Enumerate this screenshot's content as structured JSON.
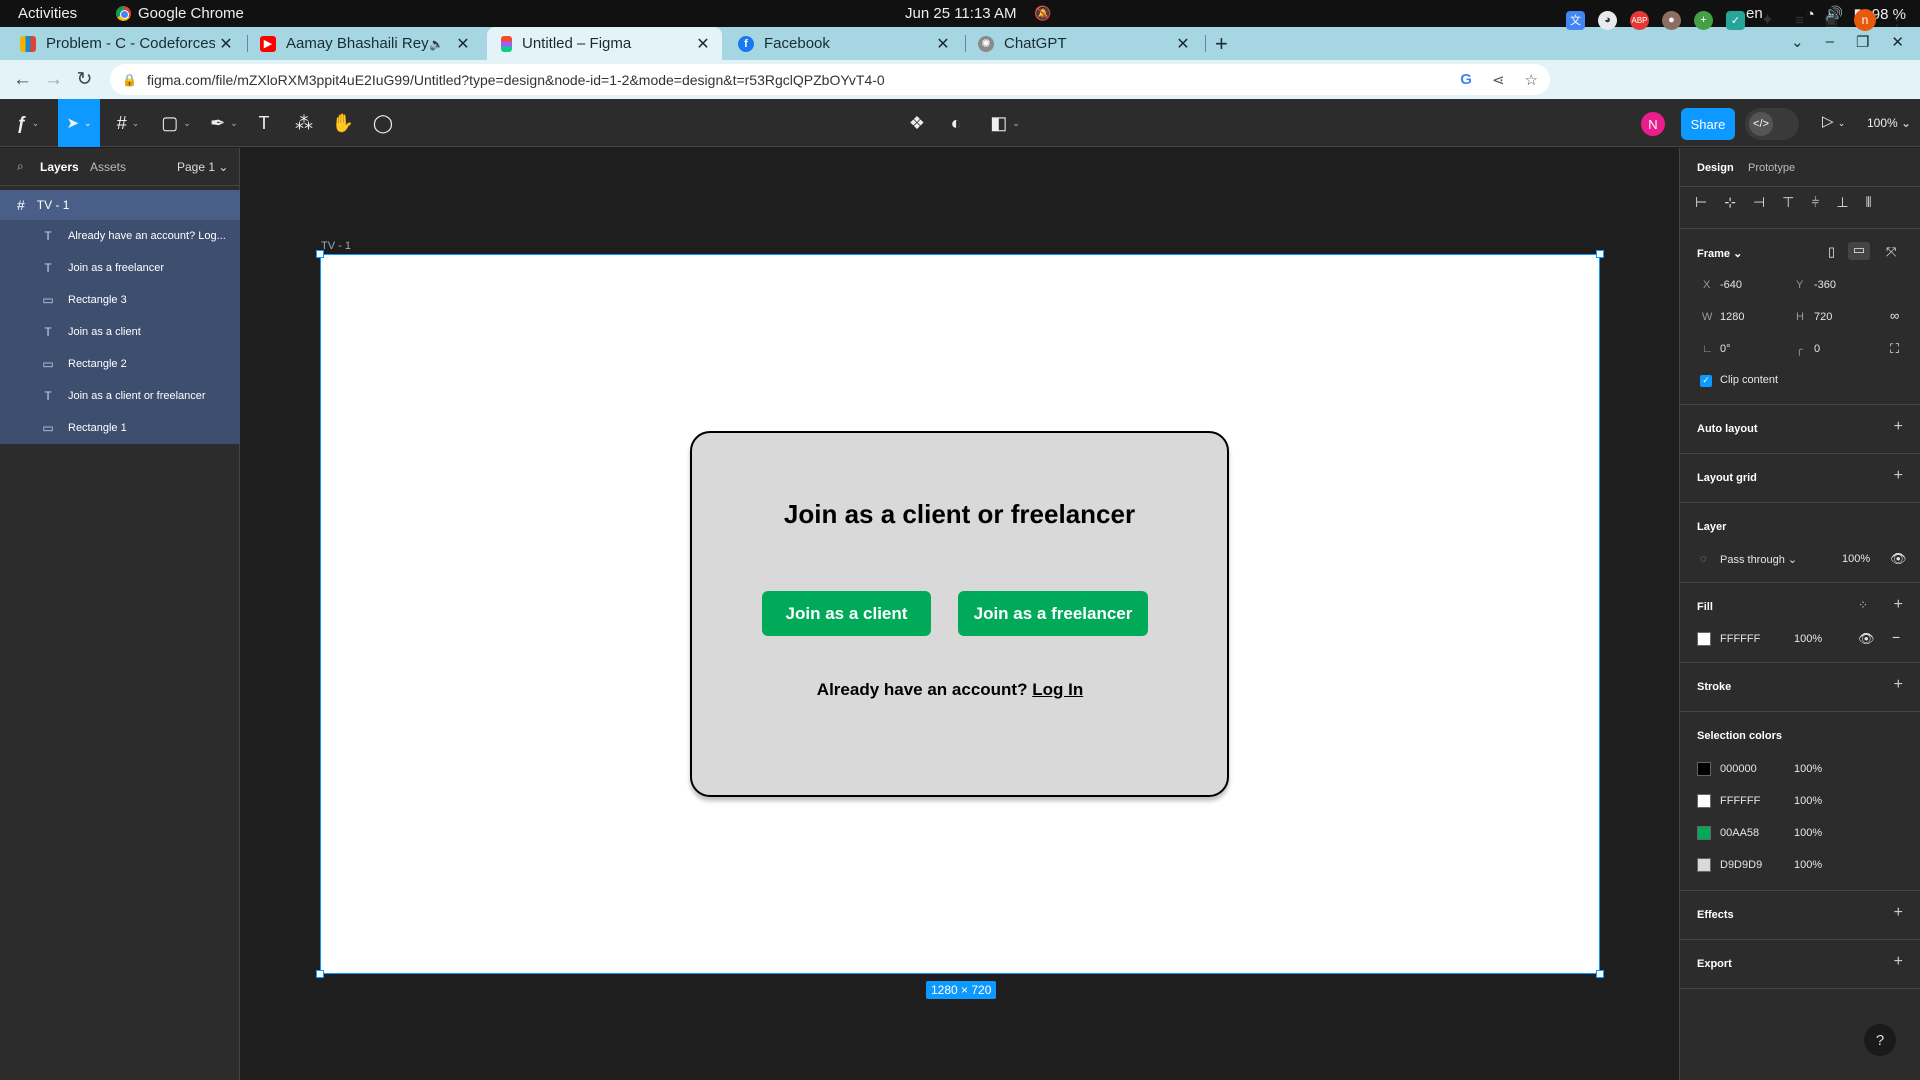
{
  "system_bar": {
    "activities": "Activities",
    "app_name": "Google Chrome",
    "datetime": "Jun 25  11:13 AM",
    "language": "en",
    "battery": "98 %"
  },
  "tabs": [
    {
      "title": "Problem - C - Codeforces",
      "favicon_color": "#1f8acb"
    },
    {
      "title": "Aamay Bhashaili Rey |",
      "favicon_color": "#ff0000"
    },
    {
      "title": "Untitled – Figma",
      "favicon_color": "#f24e1e"
    },
    {
      "title": "Facebook",
      "favicon_color": "#1877f2"
    },
    {
      "title": "ChatGPT",
      "favicon_color": "#777777"
    }
  ],
  "address_bar": {
    "url": "figma.com/file/mZXloRXM3ppit4uE2IuG99/Untitled?type=design&node-id=1-2&mode=design&t=r53RgclQPZbOYvT4-0"
  },
  "figma_toolbar": {
    "user_initial": "N",
    "share_label": "Share",
    "zoom": "100%"
  },
  "left_panel": {
    "tab_layers": "Layers",
    "tab_assets": "Assets",
    "page": "Page 1",
    "frame_name": "TV - 1",
    "layers": [
      {
        "name": "Already have an account? Log...",
        "type": "text-icon"
      },
      {
        "name": "Join as a freelancer",
        "type": "text-icon"
      },
      {
        "name": "Rectangle 3",
        "type": "rectangle-icon"
      },
      {
        "name": "Join as a client",
        "type": "text-icon"
      },
      {
        "name": "Rectangle 2",
        "type": "rectangle-icon"
      },
      {
        "name": "Join as a client or freelancer",
        "type": "text-icon"
      },
      {
        "name": "Rectangle 1",
        "type": "rectangle-icon"
      }
    ]
  },
  "canvas": {
    "frame_label": "TV - 1",
    "size_badge": "1280 × 720",
    "card_title": "Join as a client or freelancer",
    "client_button": "Join as a client",
    "freelancer_button": "Join as a freelancer",
    "login_prompt": "Already have an account?",
    "login_link": "Log In",
    "colors": {
      "green": "#00AA58",
      "card": "#D9D9D9",
      "frame": "#FFFFFF"
    }
  },
  "right_panel": {
    "tab_design": "Design",
    "tab_prototype": "Prototype",
    "frame_section": "Frame",
    "x_label": "X",
    "x_value": "-640",
    "y_label": "Y",
    "y_value": "-360",
    "w_label": "W",
    "w_value": "1280",
    "h_label": "H",
    "h_value": "720",
    "rotation": "0°",
    "corner_radius": "0",
    "clip_content": "Clip content",
    "auto_layout": "Auto layout",
    "layout_grid": "Layout grid",
    "layer_section": "Layer",
    "blend_mode": "Pass through",
    "layer_opacity": "100%",
    "fill_section": "Fill",
    "fill_hex": "FFFFFF",
    "fill_opacity": "100%",
    "stroke_section": "Stroke",
    "selection_colors_section": "Selection colors",
    "selection_colors": [
      {
        "hex": "000000",
        "opacity": "100%",
        "color": "#000000"
      },
      {
        "hex": "FFFFFF",
        "opacity": "100%",
        "color": "#FFFFFF"
      },
      {
        "hex": "00AA58",
        "opacity": "100%",
        "color": "#00AA58"
      },
      {
        "hex": "D9D9D9",
        "opacity": "100%",
        "color": "#D9D9D9"
      }
    ],
    "effects_section": "Effects",
    "export_section": "Export",
    "help": "?"
  }
}
